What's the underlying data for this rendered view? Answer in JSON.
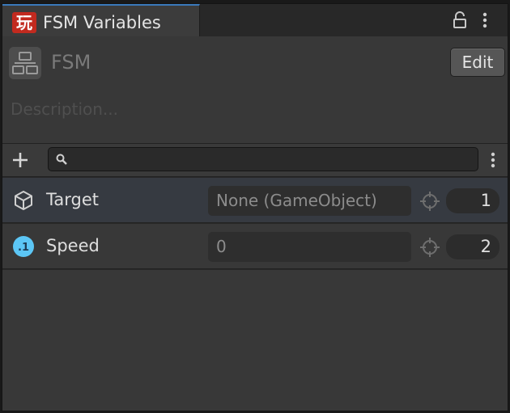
{
  "window": {
    "tab_title": "FSM Variables",
    "tab_logo_text": "玩",
    "tab_logo_color": "#c22a1f",
    "accent_color": "#3a79bb",
    "lock_icon": "lock-icon",
    "menu_icon": "kebab-menu-icon"
  },
  "header": {
    "fsm_name": "FSM",
    "edit_label": "Edit",
    "description_placeholder": "Description..."
  },
  "toolbar": {
    "add_icon": "plus-icon",
    "search_value": "",
    "search_icon": "search-icon",
    "menu_icon": "kebab-menu-icon"
  },
  "variables": [
    {
      "name": "Target",
      "type_icon": "gameobject-cube-icon",
      "value": "None (GameObject)",
      "picker_icon": "target-crosshair-icon",
      "number": "1"
    },
    {
      "name": "Speed",
      "type_icon": "float-icon",
      "type_icon_text": ".1",
      "type_icon_color": "#5cc6f5",
      "value": "0",
      "picker_icon": "target-crosshair-icon",
      "number": "2"
    }
  ]
}
